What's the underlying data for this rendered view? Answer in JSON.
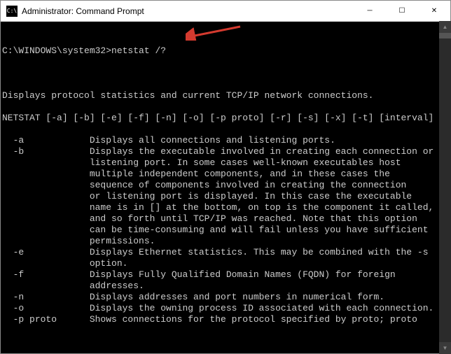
{
  "titlebar": {
    "icon_text": "C:\\",
    "title": "Administrator: Command Prompt"
  },
  "window_controls": {
    "minimize": "─",
    "maximize": "☐",
    "close": "✕"
  },
  "terminal": {
    "prompt": "C:\\WINDOWS\\system32>",
    "command": "netstat /?",
    "output": "Displays protocol statistics and current TCP/IP network connections.\n\nNETSTAT [-a] [-b] [-e] [-f] [-n] [-o] [-p proto] [-r] [-s] [-x] [-t] [interval]\n\n  -a            Displays all connections and listening ports.\n  -b            Displays the executable involved in creating each connection or\n                listening port. In some cases well-known executables host\n                multiple independent components, and in these cases the\n                sequence of components involved in creating the connection\n                or listening port is displayed. In this case the executable\n                name is in [] at the bottom, on top is the component it called,\n                and so forth until TCP/IP was reached. Note that this option\n                can be time-consuming and will fail unless you have sufficient\n                permissions.\n  -e            Displays Ethernet statistics. This may be combined with the -s\n                option.\n  -f            Displays Fully Qualified Domain Names (FQDN) for foreign\n                addresses.\n  -n            Displays addresses and port numbers in numerical form.\n  -o            Displays the owning process ID associated with each connection.\n  -p proto      Shows connections for the protocol specified by proto; proto"
  },
  "arrow": {
    "color": "#d43a2f"
  }
}
